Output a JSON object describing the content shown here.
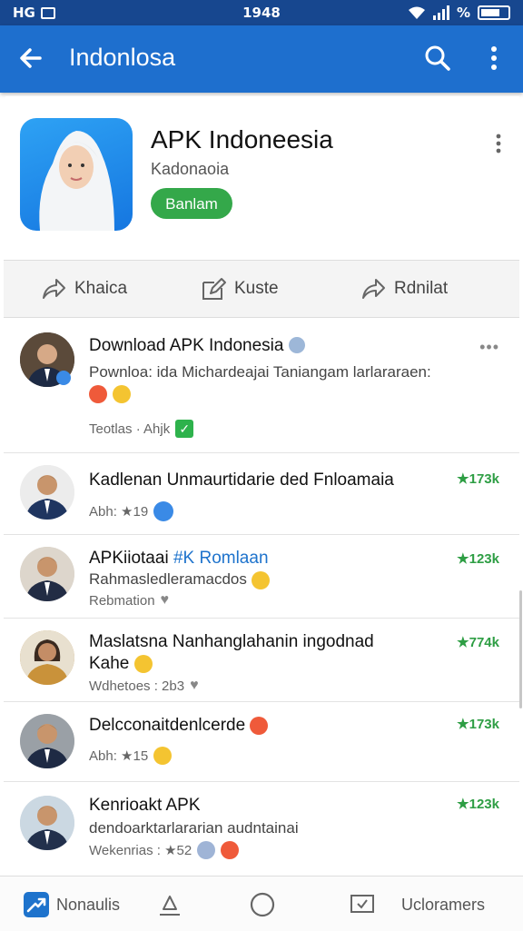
{
  "status_bar": {
    "left": "HG",
    "time": "1948",
    "battery": "%"
  },
  "appbar": {
    "title": "Indonlosa"
  },
  "app": {
    "name": "APK Indoneesia",
    "developer": "Kadonaoia",
    "install_label": "Banlam"
  },
  "actions": [
    {
      "label": "Khaica"
    },
    {
      "label": "Kuste"
    },
    {
      "label": "Rdnilat"
    }
  ],
  "posts": [
    {
      "title": "Download APK Indonesia",
      "line": "Pownloa: ida Michardeajai Taniangam larlararaen:",
      "meta": "Teotlas · Ahjk"
    },
    {
      "title": "Kadlenan Unmaurtidarie ded Fnloamaia",
      "meta": "Abh: ★19",
      "count": "★173k"
    },
    {
      "title_a": "APKiiotaai",
      "title_hash": "#K Romlaan",
      "line": "Rahmasledleramacdos",
      "meta": "Rebmation",
      "count": "★123k"
    },
    {
      "title": "Maslatsna Nanhanglahanin ingodnad",
      "line": "Kahe",
      "meta": "Wdhetoes : 2b3",
      "count": "★774k"
    },
    {
      "title": "Delcconaitdenlcerde",
      "meta": "Abh: ★15",
      "count": "★173k"
    },
    {
      "title": "Kenrioakt APK",
      "line": "dendoarktarlararian audntainai",
      "meta": "Wekenrias : ★52",
      "count": "★123k"
    }
  ],
  "bottom_nav": [
    {
      "label": "Nonaulis"
    },
    {
      "label": ""
    },
    {
      "label": ""
    },
    {
      "label": ""
    },
    {
      "label": "Ucloramers"
    }
  ],
  "colors": {
    "appbar": "#1e6fce",
    "statusbar": "#17478f",
    "install": "#34a84a",
    "count": "#2e9e44",
    "link": "#1e73cc"
  }
}
